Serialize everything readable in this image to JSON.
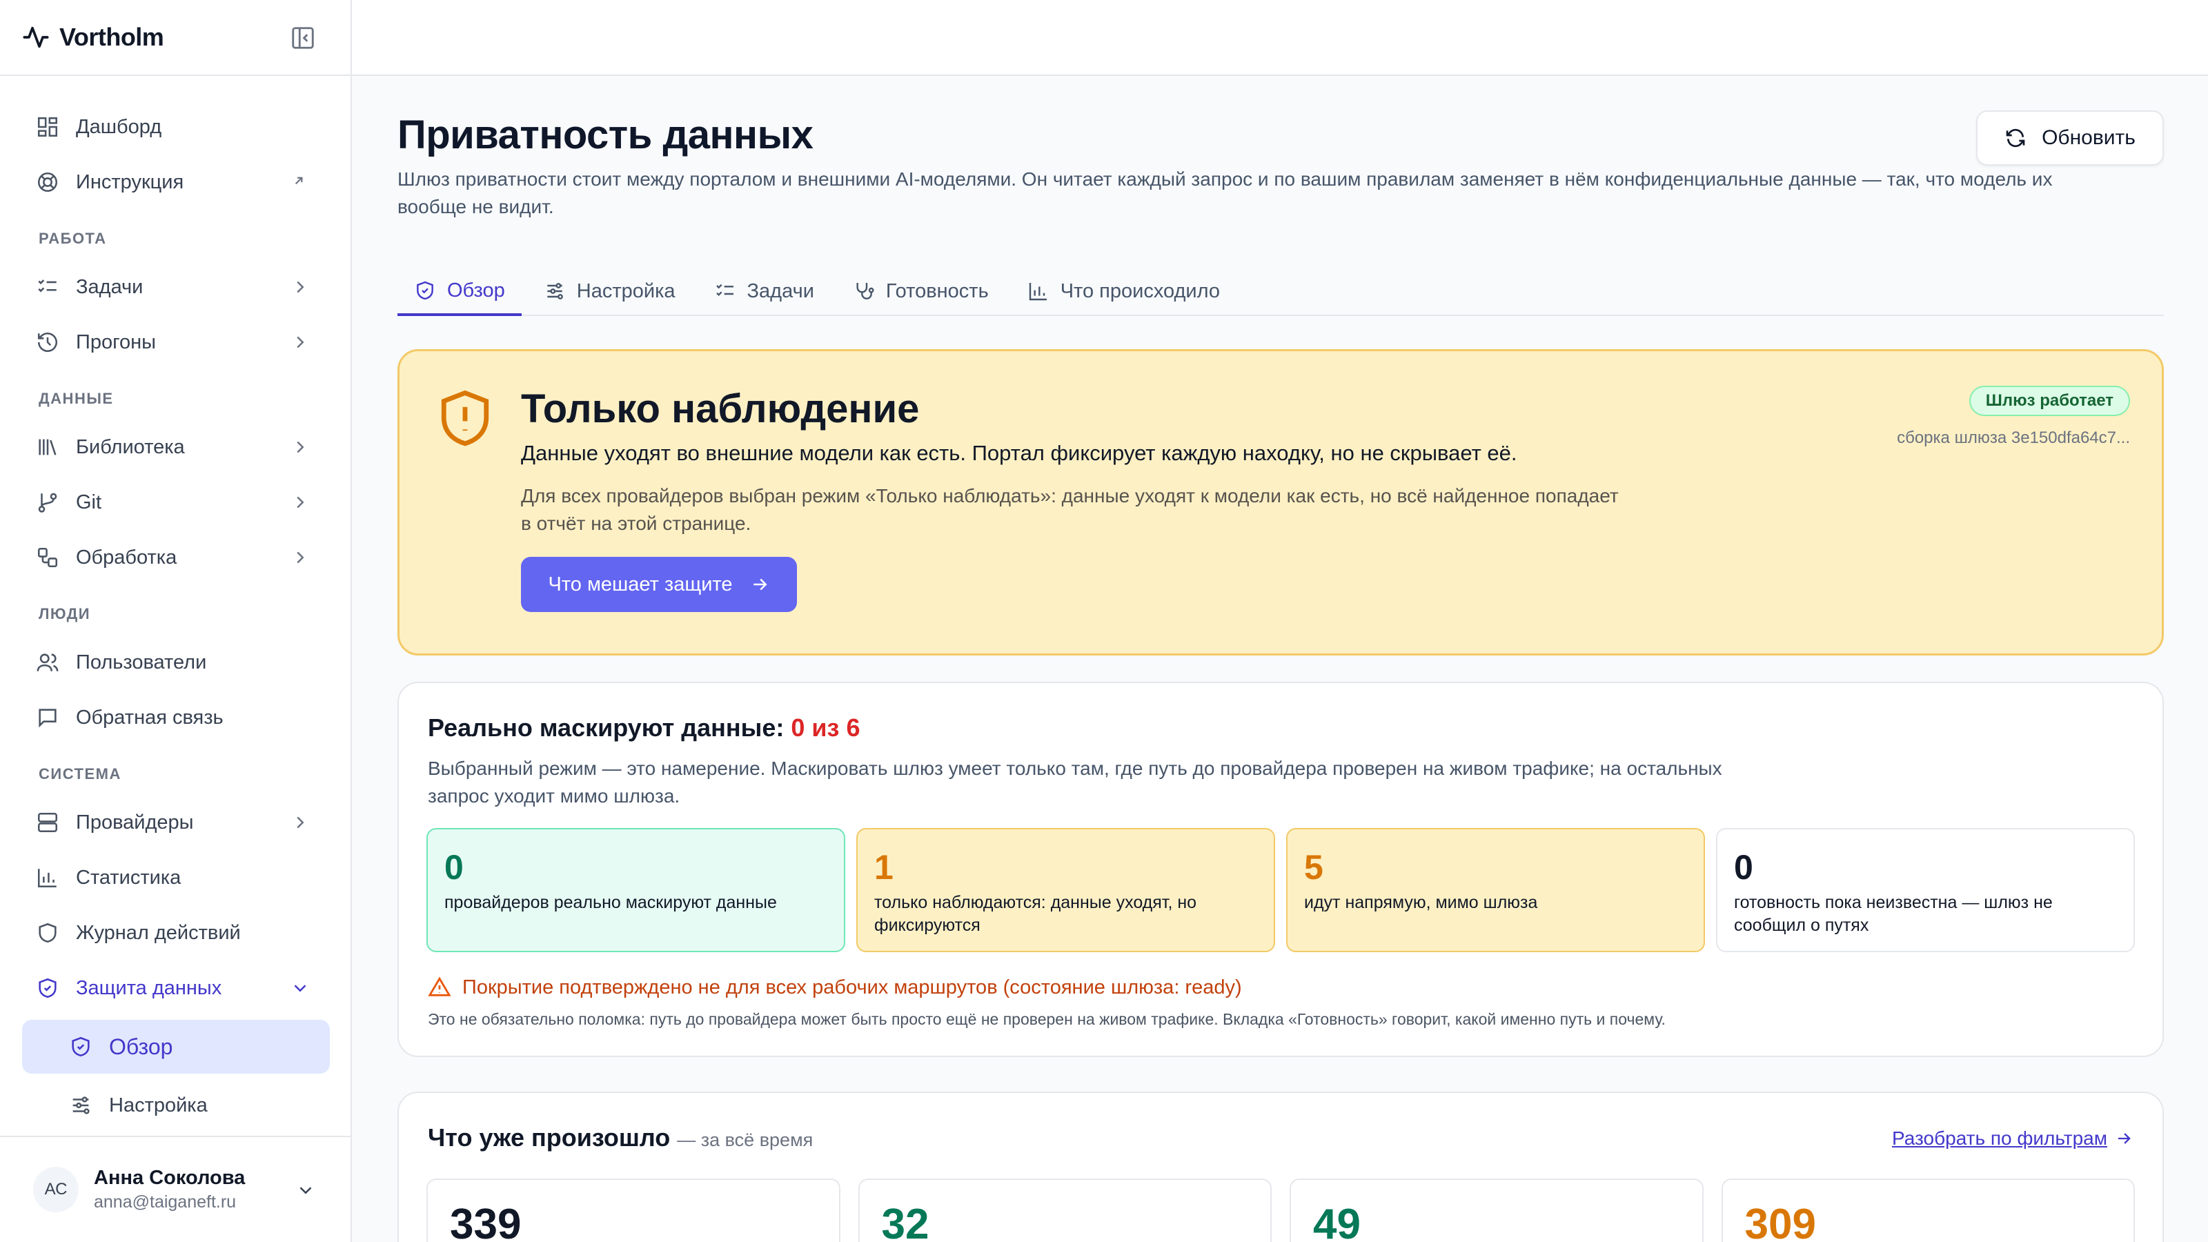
{
  "brand": {
    "name": "Vortholm"
  },
  "sidebar": {
    "top_items": [
      {
        "label": "Дашборд",
        "icon": "dashboard-icon"
      },
      {
        "label": "Инструкция",
        "icon": "lifebuoy-icon"
      }
    ],
    "sections": [
      {
        "title": "РАБОТА",
        "items": [
          {
            "label": "Задачи"
          },
          {
            "label": "Прогоны"
          }
        ]
      },
      {
        "title": "ДАННЫЕ",
        "items": [
          {
            "label": "Библиотека"
          },
          {
            "label": "Git"
          },
          {
            "label": "Обработка"
          }
        ]
      },
      {
        "title": "ЛЮДИ",
        "items": [
          {
            "label": "Пользователи"
          },
          {
            "label": "Обратная связь"
          }
        ]
      },
      {
        "title": "СИСТЕМА",
        "items": [
          {
            "label": "Провайдеры"
          },
          {
            "label": "Статистика"
          },
          {
            "label": "Журнал действий"
          },
          {
            "label": "Защита данных"
          }
        ]
      }
    ],
    "sub_items": [
      {
        "label": "Обзор"
      },
      {
        "label": "Настройка"
      }
    ]
  },
  "user": {
    "initials": "АС",
    "name": "Анна Соколова",
    "email": "anna@taiganeft.ru"
  },
  "page": {
    "title": "Приватность данных",
    "description": "Шлюз приватности стоит между порталом и внешними AI-моделями. Он читает каждый запрос и по вашим правилам заменяет в нём конфиденциальные данные — так, что модель их вообще не видит.",
    "refresh_label": "Обновить"
  },
  "tabs": [
    {
      "label": "Обзор",
      "active": true
    },
    {
      "label": "Настройка"
    },
    {
      "label": "Задачи"
    },
    {
      "label": "Готовность"
    },
    {
      "label": "Что происходило"
    }
  ],
  "banner": {
    "title": "Только наблюдение",
    "subtitle": "Данные уходят во внешние модели как есть. Портал фиксирует каждую находку, но не скрывает её.",
    "text": "Для всех провайдеров выбран режим «Только наблюдать»: данные уходят к модели как есть, но всё найденное попадает в отчёт на этой странице.",
    "button_label": "Что мешает защите",
    "status_badge": "Шлюз работает",
    "build": "сборка шлюза 3e150dfa64c7..."
  },
  "masking": {
    "title": "Реально маскируют данные:",
    "count": "0 из 6",
    "description": "Выбранный режим — это намерение. Маскировать шлюз умеет только там, где путь до провайдера проверен на живом трафике; на остальных запрос уходит мимо шлюза.",
    "stats": [
      {
        "value": "0",
        "label": "провайдеров реально маскируют данные",
        "tone": "green"
      },
      {
        "value": "1",
        "label": "только наблюдаются: данные уходят, но фиксируются",
        "tone": "yellow"
      },
      {
        "value": "5",
        "label": "идут напрямую, мимо шлюза",
        "tone": "yellow"
      },
      {
        "value": "0",
        "label": "готовность пока неизвестна — шлюз не сообщил о путях",
        "tone": "white"
      }
    ],
    "warning": "Покрытие подтверждено не для всех рабочих маршрутов (состояние шлюза: ready)",
    "note": "Это не обязательно поломка: путь до провайдера может быть просто ещё не проверен на живом трафике. Вкладка «Готовность» говорит, какой именно путь и почему."
  },
  "history": {
    "title": "Что уже произошло",
    "suffix": "— за всё время",
    "link_label": "Разобрать по фильтрам",
    "stats": [
      {
        "value": "339",
        "color": "#111827"
      },
      {
        "value": "32",
        "color": "#047857"
      },
      {
        "value": "49",
        "color": "#047857"
      },
      {
        "value": "309",
        "color": "#d97706"
      }
    ]
  },
  "colors": {
    "accent": "#4338ca",
    "button": "#6366f1",
    "warning_bg": "#fdf0c4",
    "danger": "#dc2626"
  }
}
